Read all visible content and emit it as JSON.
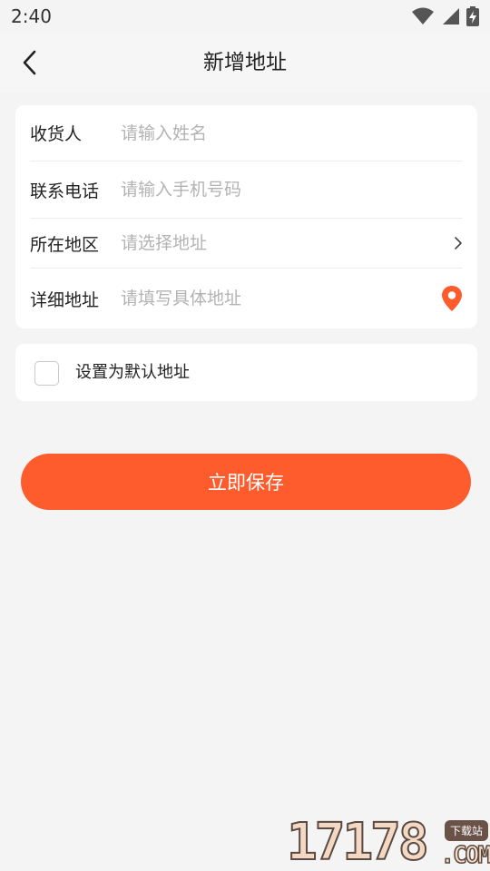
{
  "status_bar": {
    "time": "2:40",
    "icons": [
      "wifi-icon",
      "signal-icon",
      "battery-charging-icon"
    ]
  },
  "header": {
    "title": "新增地址",
    "back_icon": "chevron-left-icon"
  },
  "form": {
    "fields": [
      {
        "label": "收货人",
        "placeholder": "请输入姓名",
        "value": ""
      },
      {
        "label": "联系电话",
        "placeholder": "请输入手机号码",
        "value": ""
      },
      {
        "label": "所在地区",
        "placeholder": "请选择地址",
        "value": "",
        "icon": "chevron-right-icon"
      },
      {
        "label": "详细地址",
        "placeholder": "请填写具体地址",
        "value": "",
        "icon": "location-pin-icon"
      }
    ]
  },
  "default_address": {
    "label": "设置为默认地址",
    "checked": false
  },
  "save_button": {
    "label": "立即保存"
  },
  "watermark": {
    "number": "17178",
    "tag": "下载站",
    "suffix": ".COM"
  },
  "colors": {
    "accent": "#ff5c2e",
    "background": "#f4f4f4",
    "placeholder": "#b3b3b3"
  }
}
